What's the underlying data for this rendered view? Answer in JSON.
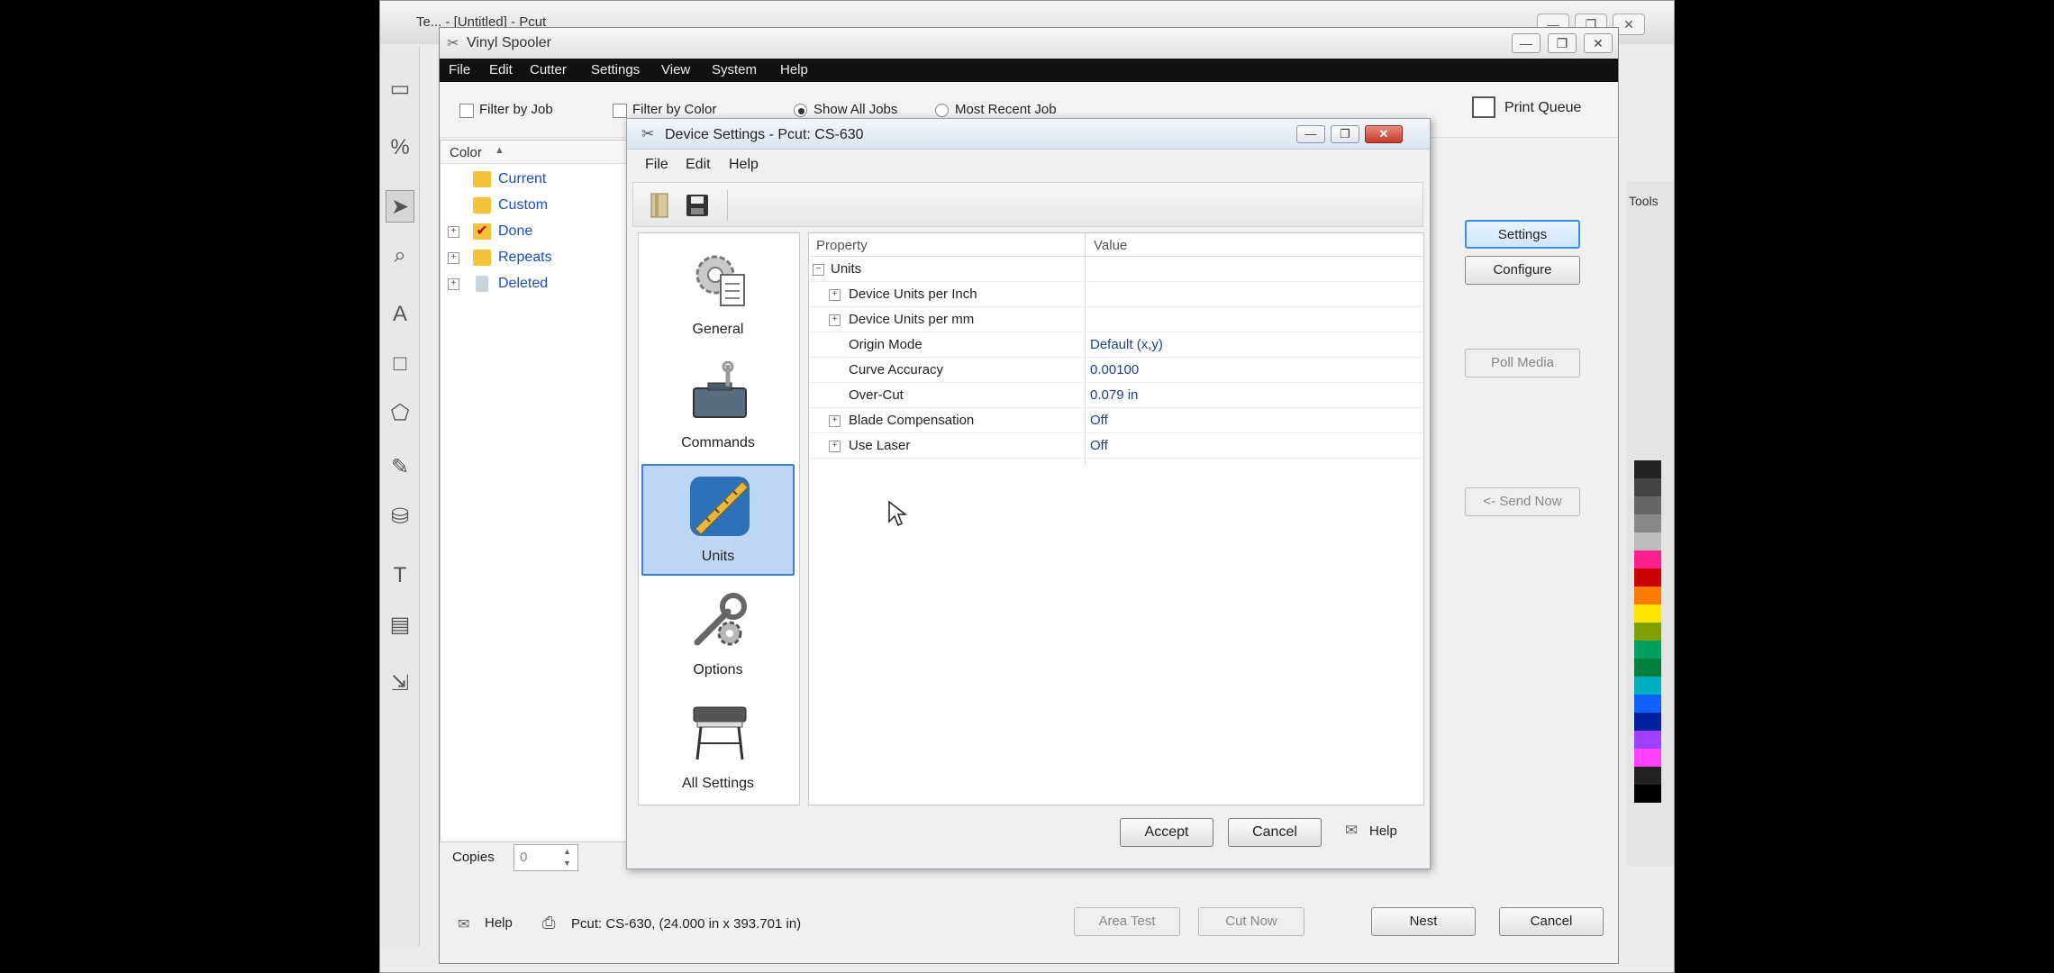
{
  "background_app": {
    "title": "Te... - [Untitled] - Pcut",
    "controls": [
      "—",
      "❐",
      "✕"
    ]
  },
  "spooler": {
    "title": "Vinyl Spooler",
    "controls": [
      "—",
      "❐",
      "✕"
    ],
    "menu": [
      "File",
      "Edit",
      "Cutter",
      "Settings",
      "View",
      "System",
      "Help"
    ],
    "filter_by_job": "Filter by Job",
    "filter_by_color": "Filter by Color",
    "show_all_jobs": "Show All Jobs",
    "most_recent_job": "Most Recent Job",
    "print_queue": "Print Queue",
    "color_header": "Color",
    "tree": [
      "Current",
      "Custom",
      "Done",
      "Repeats",
      "Deleted"
    ],
    "copies_label": "Copies",
    "copies_value": "0",
    "help": "Help",
    "device_status": "Pcut: CS-630,  (24.000 in x 393.701 in)",
    "buttons": {
      "settings": "Settings",
      "configure": "Configure",
      "poll_media": "Poll Media",
      "send_now": "<- Send Now",
      "area_test": "Area Test",
      "cut_now": "Cut Now",
      "nest": "Nest",
      "cancel": "Cancel"
    },
    "tools_label": "Tools"
  },
  "dialog": {
    "title": "Device Settings - Pcut: CS-630",
    "controls": [
      "—",
      "❐",
      "✕"
    ],
    "menu": [
      "File",
      "Edit",
      "Help"
    ],
    "sidebar": [
      "General",
      "Commands",
      "Units",
      "Options",
      "All Settings"
    ],
    "selected": "Units",
    "grid_header": {
      "property": "Property",
      "value": "Value"
    },
    "rows": [
      {
        "property": "Units",
        "value": "",
        "level": 0,
        "expander": "−"
      },
      {
        "property": "Device Units per Inch",
        "value": "",
        "level": 1,
        "expander": "+"
      },
      {
        "property": "Device Units per mm",
        "value": "",
        "level": 1,
        "expander": "+"
      },
      {
        "property": "Origin Mode",
        "value": "Default (x,y)",
        "level": 1,
        "expander": ""
      },
      {
        "property": "Curve Accuracy",
        "value": "0.00100",
        "level": 1,
        "expander": ""
      },
      {
        "property": "Over-Cut",
        "value": "0.079 in",
        "level": 1,
        "expander": ""
      },
      {
        "property": "Blade Compensation",
        "value": "Off",
        "level": 1,
        "expander": "+"
      },
      {
        "property": "Use Laser",
        "value": "Off",
        "level": 1,
        "expander": "+"
      }
    ],
    "accept": "Accept",
    "cancel": "Cancel",
    "help": "Help"
  },
  "colors": {
    "selection": "#bcd6f4",
    "link": "#1a4fc0"
  }
}
